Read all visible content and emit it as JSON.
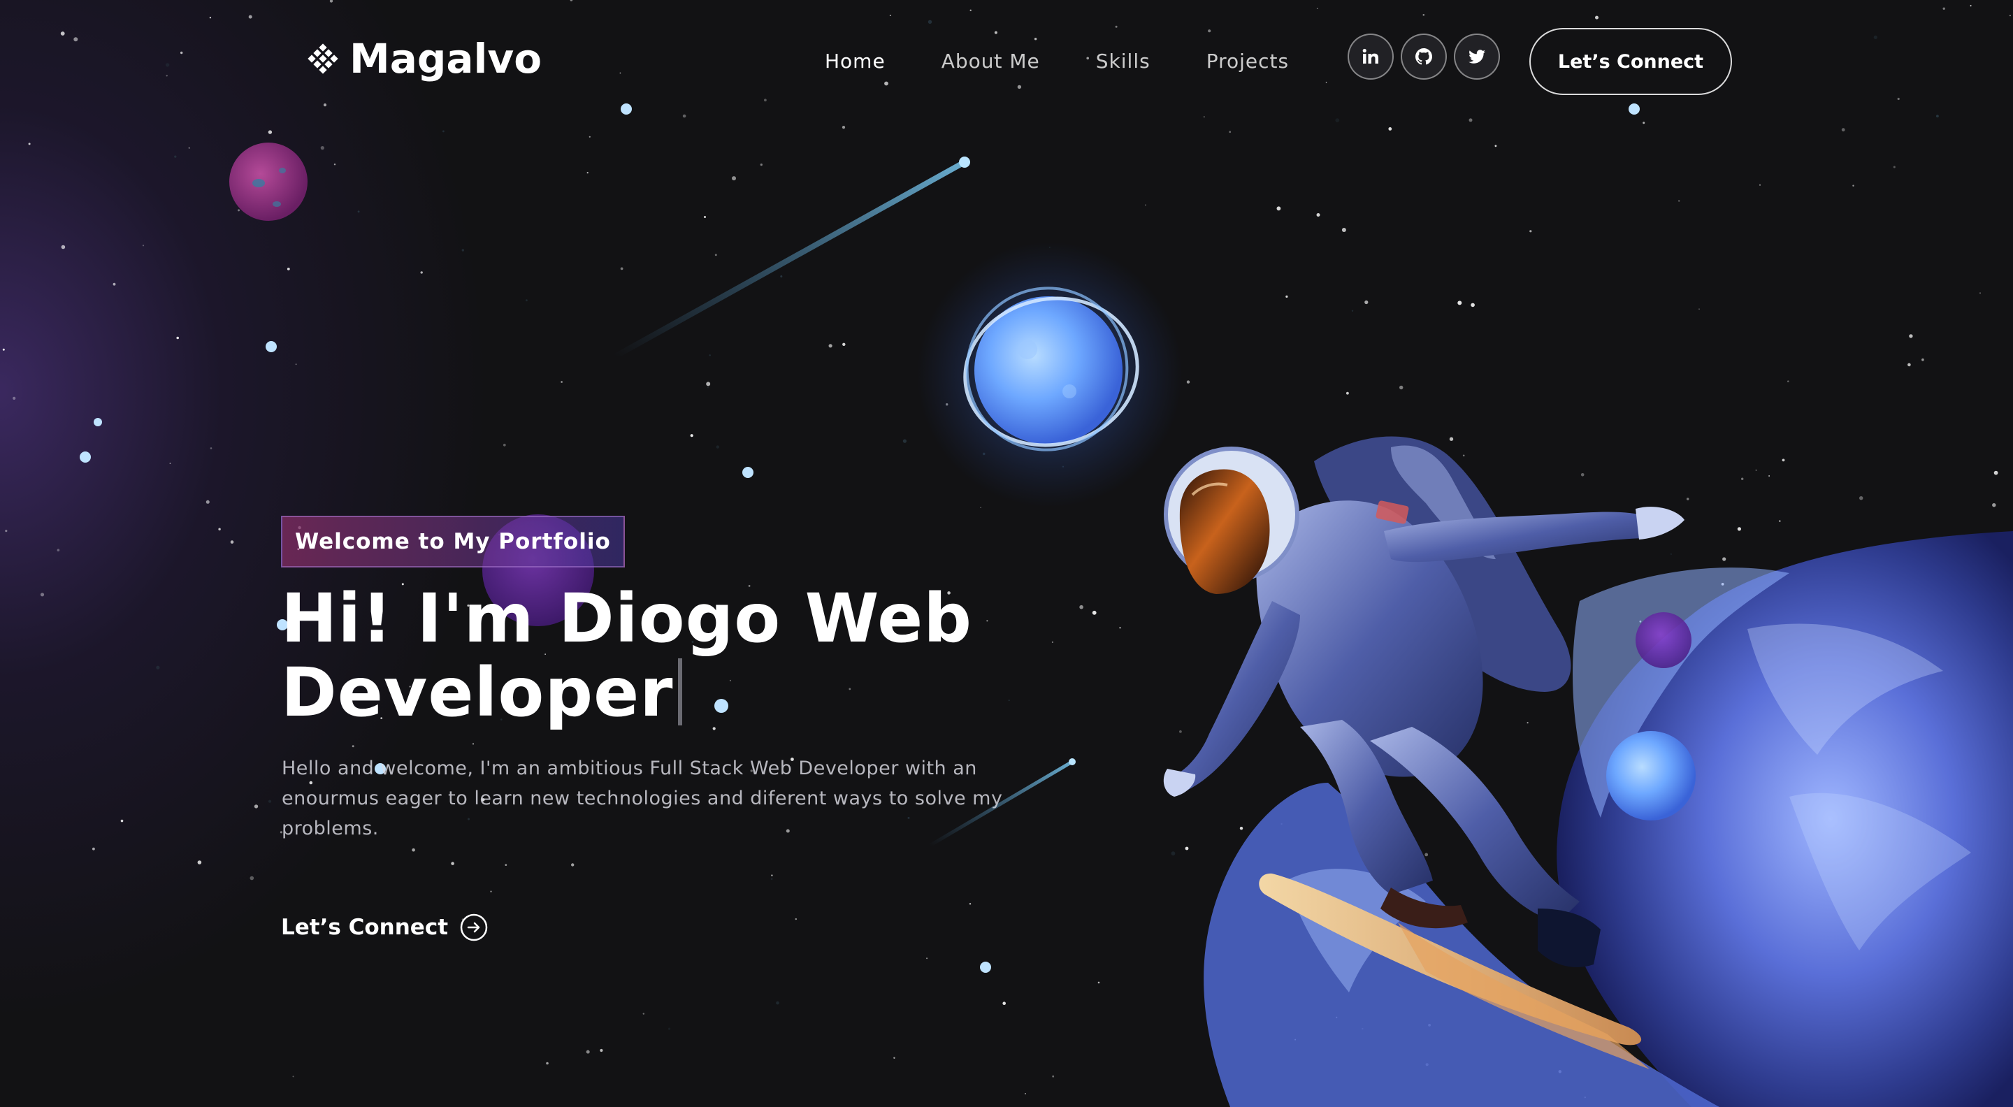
{
  "brand": {
    "name": "Magalvo",
    "logo_icon": "diamond-grid-icon"
  },
  "nav": {
    "links": [
      {
        "label": "Home",
        "active": true
      },
      {
        "label": "About Me",
        "active": false
      },
      {
        "label": "Skills",
        "active": false
      },
      {
        "label": "Projects",
        "active": false
      }
    ],
    "socials": [
      {
        "icon": "linkedin-icon"
      },
      {
        "icon": "github-icon"
      },
      {
        "icon": "twitter-icon"
      }
    ],
    "cta_label": "Let’s Connect"
  },
  "hero": {
    "tagline": "Welcome to My Portfolio",
    "headline_line1": "Hi! I'm Diogo Web",
    "headline_line2": "Developer",
    "intro": "Hello and welcome, I'm an ambitious Full Stack Web Developer with an enourmus eager to learn new technologies and diferent ways to solve my problems.",
    "cta_label": "Let’s Connect",
    "cta_icon": "arrow-right-circle-icon"
  },
  "colors": {
    "background": "#121214",
    "accent_purple": "#aa367c",
    "accent_blue": "#4a2fbd",
    "planet_blue": "#7ab6ff"
  }
}
